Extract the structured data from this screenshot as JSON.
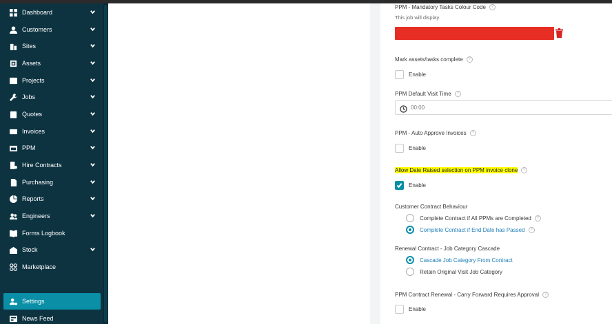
{
  "sidebar": {
    "items": [
      {
        "label": "Dashboard",
        "icon": "dashboard-icon",
        "chevron": true
      },
      {
        "label": "Customers",
        "icon": "user-icon",
        "chevron": true
      },
      {
        "label": "Sites",
        "icon": "building-icon",
        "chevron": true
      },
      {
        "label": "Assets",
        "icon": "asset-icon",
        "chevron": true
      },
      {
        "label": "Projects",
        "icon": "projects-icon",
        "chevron": true
      },
      {
        "label": "Jobs",
        "icon": "wrench-icon",
        "chevron": true
      },
      {
        "label": "Quotes",
        "icon": "clipboard-icon",
        "chevron": true
      },
      {
        "label": "Invoices",
        "icon": "invoice-icon",
        "chevron": true
      },
      {
        "label": "PPM",
        "icon": "ppm-icon",
        "chevron": true
      },
      {
        "label": "Hire Contracts",
        "icon": "hire-icon",
        "chevron": true
      },
      {
        "label": "Purchasing",
        "icon": "document-icon",
        "chevron": true
      },
      {
        "label": "Reports",
        "icon": "pie-chart-icon",
        "chevron": true
      },
      {
        "label": "Engineers",
        "icon": "users-icon",
        "chevron": true
      },
      {
        "label": "Forms Logbook",
        "icon": "book-icon",
        "chevron": false
      },
      {
        "label": "Stock",
        "icon": "stock-icon",
        "chevron": true
      },
      {
        "label": "Marketplace",
        "icon": "grid-icon",
        "chevron": false
      }
    ],
    "settings_label": "Settings",
    "news_label": "News Feed"
  },
  "settings": {
    "colour_code": {
      "title": "PPM - Mandatory Tasks Colour Code",
      "subtitle": "This job will display",
      "color": "#e62e24"
    },
    "mark_complete": {
      "title": "Mark assets/tasks complete",
      "enable_label": "Enable",
      "checked": false
    },
    "default_visit_time": {
      "title": "PPM Default Visit Time",
      "value": "00:00"
    },
    "auto_approve": {
      "title": "PPM - Auto Approve Invoices",
      "enable_label": "Enable",
      "checked": false
    },
    "allow_date_raised": {
      "title": "Allow Date Raised selection on PPM invoice clone",
      "enable_label": "Enable",
      "checked": true
    },
    "contract_behaviour": {
      "title": "Customer Contract Behaviour",
      "options": [
        "Complete Contract if All PPMs are Completed",
        "Complete Contract if End Date has Passed"
      ],
      "selected": 1
    },
    "renewal_cascade": {
      "title": "Renewal Contract - Job Category Cascade",
      "options": [
        "Cascade Job Category From Contract",
        "Retain Original Visit Job Category"
      ],
      "selected": 0
    },
    "carry_forward": {
      "title": "PPM Contract Renewal - Carry Forward Requires Approval",
      "enable_label": "Enable",
      "checked": false
    }
  },
  "colors": {
    "sidebar_bg": "#0d3341",
    "accent": "#0a8fa6",
    "danger": "#d92424",
    "highlight": "#ffff00"
  }
}
